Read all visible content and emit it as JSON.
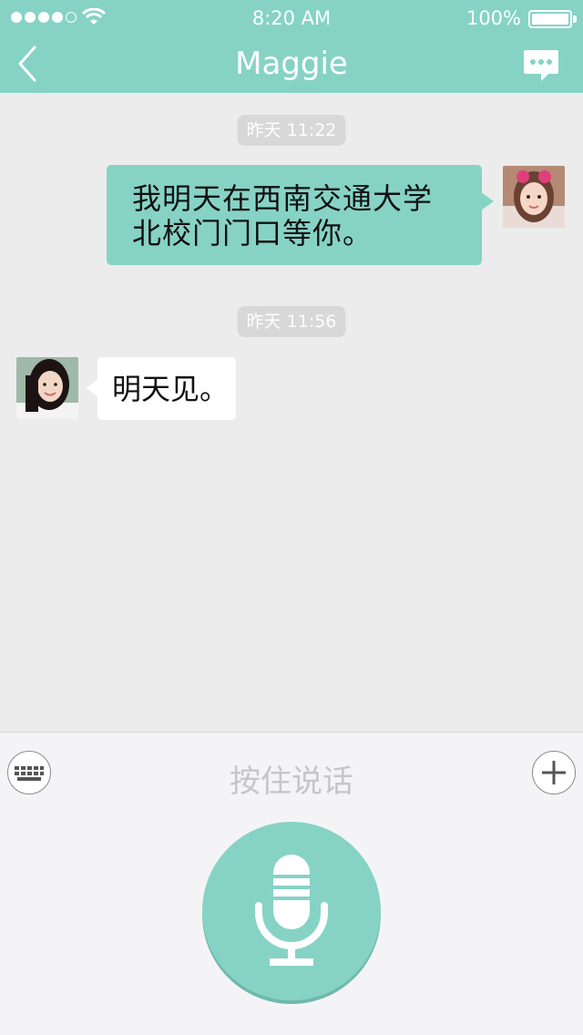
{
  "status_bar": {
    "time": "8:20 AM",
    "battery": "100%",
    "battery_level": 1.0,
    "signal_bars_filled": 4,
    "signal_bars_total": 5
  },
  "nav": {
    "title": "Maggie",
    "back_icon": "chevron-left-icon",
    "chat_icon": "chat-bubble-icon"
  },
  "messages": [
    {
      "timestamp": "昨天 11:22",
      "direction": "outgoing",
      "text_lines": [
        "我明天在西南交通大学",
        "北校门门口等你。"
      ]
    },
    {
      "timestamp": "昨天 11:56",
      "direction": "incoming",
      "text": "明天见。"
    }
  ],
  "input": {
    "hold_to_talk": "按住说话",
    "keyboard_icon": "keyboard-icon",
    "plus_icon": "plus-icon",
    "mic_icon": "microphone-icon"
  },
  "colors": {
    "accent": "#86d3c5",
    "background": "#ececec",
    "panel": "#f4f4f6"
  }
}
